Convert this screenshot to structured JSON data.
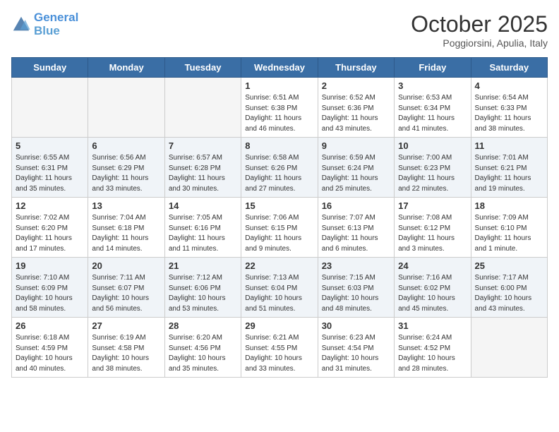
{
  "logo": {
    "line1": "General",
    "line2": "Blue"
  },
  "title": "October 2025",
  "subtitle": "Poggiorsini, Apulia, Italy",
  "weekdays": [
    "Sunday",
    "Monday",
    "Tuesday",
    "Wednesday",
    "Thursday",
    "Friday",
    "Saturday"
  ],
  "weeks": [
    [
      {
        "day": "",
        "info": ""
      },
      {
        "day": "",
        "info": ""
      },
      {
        "day": "",
        "info": ""
      },
      {
        "day": "1",
        "info": "Sunrise: 6:51 AM\nSunset: 6:38 PM\nDaylight: 11 hours and 46 minutes."
      },
      {
        "day": "2",
        "info": "Sunrise: 6:52 AM\nSunset: 6:36 PM\nDaylight: 11 hours and 43 minutes."
      },
      {
        "day": "3",
        "info": "Sunrise: 6:53 AM\nSunset: 6:34 PM\nDaylight: 11 hours and 41 minutes."
      },
      {
        "day": "4",
        "info": "Sunrise: 6:54 AM\nSunset: 6:33 PM\nDaylight: 11 hours and 38 minutes."
      }
    ],
    [
      {
        "day": "5",
        "info": "Sunrise: 6:55 AM\nSunset: 6:31 PM\nDaylight: 11 hours and 35 minutes."
      },
      {
        "day": "6",
        "info": "Sunrise: 6:56 AM\nSunset: 6:29 PM\nDaylight: 11 hours and 33 minutes."
      },
      {
        "day": "7",
        "info": "Sunrise: 6:57 AM\nSunset: 6:28 PM\nDaylight: 11 hours and 30 minutes."
      },
      {
        "day": "8",
        "info": "Sunrise: 6:58 AM\nSunset: 6:26 PM\nDaylight: 11 hours and 27 minutes."
      },
      {
        "day": "9",
        "info": "Sunrise: 6:59 AM\nSunset: 6:24 PM\nDaylight: 11 hours and 25 minutes."
      },
      {
        "day": "10",
        "info": "Sunrise: 7:00 AM\nSunset: 6:23 PM\nDaylight: 11 hours and 22 minutes."
      },
      {
        "day": "11",
        "info": "Sunrise: 7:01 AM\nSunset: 6:21 PM\nDaylight: 11 hours and 19 minutes."
      }
    ],
    [
      {
        "day": "12",
        "info": "Sunrise: 7:02 AM\nSunset: 6:20 PM\nDaylight: 11 hours and 17 minutes."
      },
      {
        "day": "13",
        "info": "Sunrise: 7:04 AM\nSunset: 6:18 PM\nDaylight: 11 hours and 14 minutes."
      },
      {
        "day": "14",
        "info": "Sunrise: 7:05 AM\nSunset: 6:16 PM\nDaylight: 11 hours and 11 minutes."
      },
      {
        "day": "15",
        "info": "Sunrise: 7:06 AM\nSunset: 6:15 PM\nDaylight: 11 hours and 9 minutes."
      },
      {
        "day": "16",
        "info": "Sunrise: 7:07 AM\nSunset: 6:13 PM\nDaylight: 11 hours and 6 minutes."
      },
      {
        "day": "17",
        "info": "Sunrise: 7:08 AM\nSunset: 6:12 PM\nDaylight: 11 hours and 3 minutes."
      },
      {
        "day": "18",
        "info": "Sunrise: 7:09 AM\nSunset: 6:10 PM\nDaylight: 11 hours and 1 minute."
      }
    ],
    [
      {
        "day": "19",
        "info": "Sunrise: 7:10 AM\nSunset: 6:09 PM\nDaylight: 10 hours and 58 minutes."
      },
      {
        "day": "20",
        "info": "Sunrise: 7:11 AM\nSunset: 6:07 PM\nDaylight: 10 hours and 56 minutes."
      },
      {
        "day": "21",
        "info": "Sunrise: 7:12 AM\nSunset: 6:06 PM\nDaylight: 10 hours and 53 minutes."
      },
      {
        "day": "22",
        "info": "Sunrise: 7:13 AM\nSunset: 6:04 PM\nDaylight: 10 hours and 51 minutes."
      },
      {
        "day": "23",
        "info": "Sunrise: 7:15 AM\nSunset: 6:03 PM\nDaylight: 10 hours and 48 minutes."
      },
      {
        "day": "24",
        "info": "Sunrise: 7:16 AM\nSunset: 6:02 PM\nDaylight: 10 hours and 45 minutes."
      },
      {
        "day": "25",
        "info": "Sunrise: 7:17 AM\nSunset: 6:00 PM\nDaylight: 10 hours and 43 minutes."
      }
    ],
    [
      {
        "day": "26",
        "info": "Sunrise: 6:18 AM\nSunset: 4:59 PM\nDaylight: 10 hours and 40 minutes."
      },
      {
        "day": "27",
        "info": "Sunrise: 6:19 AM\nSunset: 4:58 PM\nDaylight: 10 hours and 38 minutes."
      },
      {
        "day": "28",
        "info": "Sunrise: 6:20 AM\nSunset: 4:56 PM\nDaylight: 10 hours and 35 minutes."
      },
      {
        "day": "29",
        "info": "Sunrise: 6:21 AM\nSunset: 4:55 PM\nDaylight: 10 hours and 33 minutes."
      },
      {
        "day": "30",
        "info": "Sunrise: 6:23 AM\nSunset: 4:54 PM\nDaylight: 10 hours and 31 minutes."
      },
      {
        "day": "31",
        "info": "Sunrise: 6:24 AM\nSunset: 4:52 PM\nDaylight: 10 hours and 28 minutes."
      },
      {
        "day": "",
        "info": ""
      }
    ]
  ]
}
